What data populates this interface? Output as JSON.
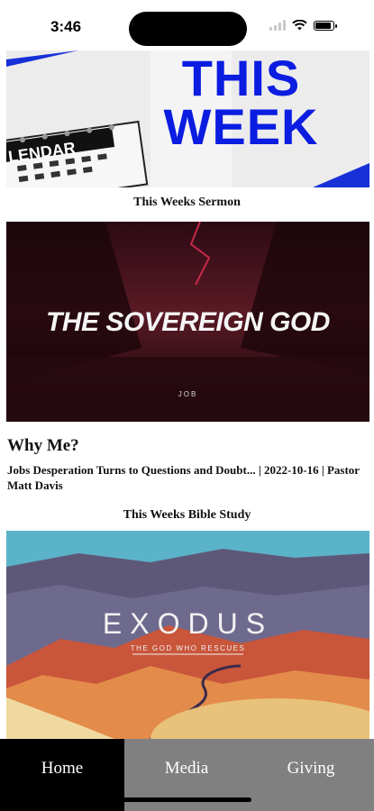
{
  "status": {
    "time": "3:46"
  },
  "hero": {
    "title_line1": "THIS",
    "title_line2": "WEEK",
    "calendar_text": "LENDAR"
  },
  "sermon_section": {
    "heading": "This Weeks Sermon",
    "graphic_title": "THE SOVEREIGN GOD",
    "graphic_subtitle": "JOB",
    "title": "Why Me?",
    "details": "Jobs Desperation Turns to Questions and Doubt... | 2022-10-16 | Pastor Matt Davis"
  },
  "study_section": {
    "heading": "This Weeks Bible Study",
    "graphic_title": "EXODUS",
    "graphic_subtitle": "THE GOD WHO RESCUES"
  },
  "tabs": [
    {
      "label": "Home",
      "active": true
    },
    {
      "label": "Media",
      "active": false
    },
    {
      "label": "Giving",
      "active": false
    }
  ],
  "colors": {
    "hero_blue": "#0b1de0",
    "tab_active": "#000000",
    "tab_inactive": "#808080"
  }
}
